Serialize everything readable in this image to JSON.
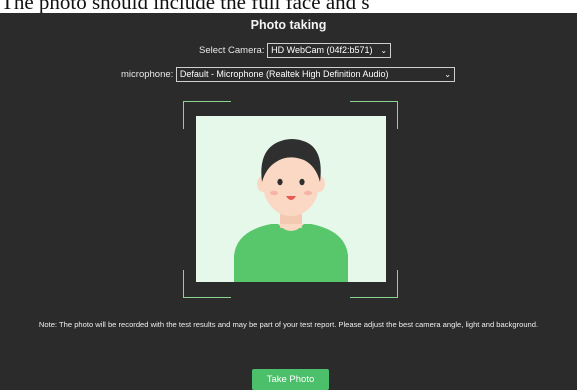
{
  "top_strip": {
    "text": "The photo should include the full face and s"
  },
  "panel": {
    "title": "Photo taking",
    "camera": {
      "label": "Select Camera:",
      "value": "HD WebCam (04f2:b571)"
    },
    "microphone": {
      "label": "microphone:",
      "value": "Default - Microphone (Realtek High Definition Audio)"
    },
    "note": "Note: The photo will be recorded with the test results and may be part of your test report. Please adjust the best camera angle, light and background.",
    "take_photo_label": "Take Photo"
  },
  "icons": {
    "dropdown": "chevron-down-icon",
    "avatar": "person-avatar-illustration"
  },
  "colors": {
    "panel_bg": "#2b2b2b",
    "accent_green": "#4cbf6a",
    "frame_green": "#8bd48f",
    "photo_bg": "#e6f8ea",
    "shirt": "#58c76b",
    "hair": "#2f2f2f",
    "skin": "#fbd8c4"
  }
}
